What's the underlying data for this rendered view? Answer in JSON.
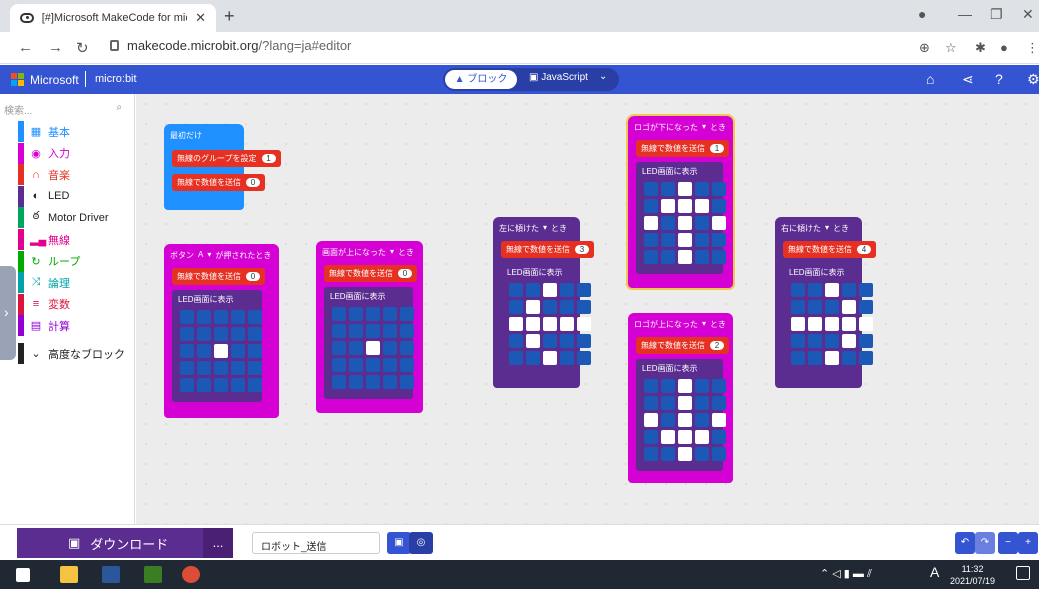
{
  "browser": {
    "tab_title": "[#]Microsoft MakeCode for micro",
    "url_domain": "makecode.microbit.org",
    "url_path": "/?lang=ja#editor"
  },
  "header": {
    "ms_label": "Microsoft",
    "microbit_label": "micro:bit",
    "blocks_label": "ブロック",
    "javascript_label": "JavaScript"
  },
  "toolbox": {
    "search_placeholder": "検索...",
    "categories": [
      {
        "label": "基本",
        "color": "#1e90ff",
        "icon": "grid-icon"
      },
      {
        "label": "入力",
        "color": "#d400d4",
        "icon": "target-icon"
      },
      {
        "label": "音楽",
        "color": "#e63022",
        "icon": "headphones-icon"
      },
      {
        "label": "LED",
        "color": "#5c2d91",
        "icon": "toggle-icon"
      },
      {
        "label": "Motor Driver",
        "color": "#00a65c",
        "icon": "bike-icon"
      },
      {
        "label": "無線",
        "color": "#e3008c",
        "icon": "signal-icon"
      },
      {
        "label": "ループ",
        "color": "#00aa00",
        "icon": "loop-icon"
      },
      {
        "label": "論理",
        "color": "#00a4a6",
        "icon": "shuffle-icon"
      },
      {
        "label": "変数",
        "color": "#dc143c",
        "icon": "list-icon"
      },
      {
        "label": "計算",
        "color": "#9400d3",
        "icon": "calculator-icon"
      }
    ],
    "advanced_label": "高度なブロック"
  },
  "blocks": {
    "on_start": {
      "label": "最初だけ",
      "set_group": "無線のグループを設定",
      "group_val": "1",
      "send": "無線で数値を送信",
      "send_val": "0"
    },
    "button": {
      "label": "ボタン",
      "button": "A",
      "suffix": "が押されたとき",
      "send": "無線で数値を送信",
      "send_val": "0",
      "led": "LED画面に表示"
    },
    "screen_up": {
      "label": "画面が上になった",
      "suffix": "とき",
      "send": "無線で数値を送信",
      "send_val": "0",
      "led": "LED画面に表示"
    },
    "tilt_left": {
      "label": "左に傾けた",
      "suffix": "とき",
      "send": "無線で数値を送信",
      "send_val": "3",
      "led": "LED画面に表示"
    },
    "logo_down": {
      "label": "ロゴが下になった",
      "suffix": "とき",
      "send": "無線で数値を送信",
      "send_val": "1",
      "led": "LED画面に表示"
    },
    "logo_up": {
      "label": "ロゴが上になった",
      "suffix": "とき",
      "send": "無線で数値を送信",
      "send_val": "2",
      "led": "LED画面に表示"
    },
    "tilt_right": {
      "label": "右に傾けた",
      "suffix": "とき",
      "send": "無線で数値を送信",
      "send_val": "4",
      "led": "LED画面に表示"
    }
  },
  "leds": {
    "button": [
      0,
      0,
      0,
      0,
      0,
      0,
      0,
      0,
      0,
      0,
      0,
      0,
      1,
      0,
      0,
      0,
      0,
      0,
      0,
      0,
      0,
      0,
      0,
      0,
      0
    ],
    "screen_up": [
      0,
      0,
      0,
      0,
      0,
      0,
      0,
      0,
      0,
      0,
      0,
      0,
      1,
      0,
      0,
      0,
      0,
      0,
      0,
      0,
      0,
      0,
      0,
      0,
      0
    ],
    "tilt_left": [
      0,
      0,
      1,
      0,
      0,
      0,
      1,
      0,
      0,
      0,
      1,
      1,
      1,
      1,
      1,
      0,
      1,
      0,
      0,
      0,
      0,
      0,
      1,
      0,
      0
    ],
    "logo_down": [
      0,
      0,
      1,
      0,
      0,
      0,
      1,
      1,
      1,
      0,
      1,
      0,
      1,
      0,
      1,
      0,
      0,
      1,
      0,
      0,
      0,
      0,
      1,
      0,
      0
    ],
    "logo_up": [
      0,
      0,
      1,
      0,
      0,
      0,
      0,
      1,
      0,
      0,
      1,
      0,
      1,
      0,
      1,
      0,
      1,
      1,
      1,
      0,
      0,
      0,
      1,
      0,
      0
    ],
    "tilt_right": [
      0,
      0,
      1,
      0,
      0,
      0,
      0,
      0,
      1,
      0,
      1,
      1,
      1,
      1,
      1,
      0,
      0,
      0,
      1,
      0,
      0,
      0,
      1,
      0,
      0
    ]
  },
  "bottom": {
    "download_label": "ダウンロード",
    "more_label": "...",
    "project_name": "ロボット_送信"
  },
  "taskbar": {
    "time": "11:32",
    "date": "2021/07/19",
    "ime": "A"
  },
  "colors": {
    "header_blue": "#3454d1",
    "radio_red": "#e63022",
    "input_magenta": "#d400d4",
    "basic_blue": "#1e90ff",
    "led_purple": "#5c2d91"
  }
}
